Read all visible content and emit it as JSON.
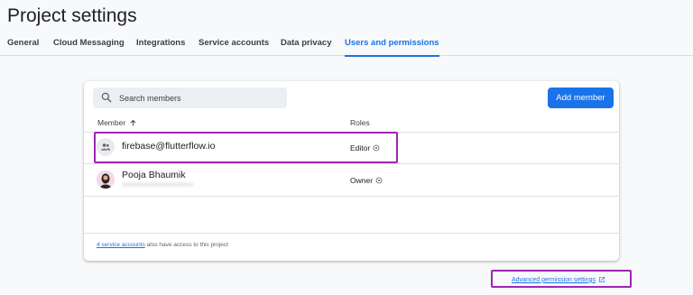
{
  "page_title": "Project settings",
  "tabs": [
    {
      "label": "General",
      "active": false
    },
    {
      "label": "Cloud Messaging",
      "active": false
    },
    {
      "label": "Integrations",
      "active": false
    },
    {
      "label": "Service accounts",
      "active": false
    },
    {
      "label": "Data privacy",
      "active": false
    },
    {
      "label": "Users and permissions",
      "active": true
    }
  ],
  "search": {
    "placeholder": "Search members",
    "icon": "search-icon"
  },
  "add_member_label": "Add member",
  "columns": {
    "member": "Member",
    "roles": "Roles",
    "sort_icon": "arrow-up-icon"
  },
  "members": [
    {
      "name": "firebase@flutterflow.io",
      "role": "Editor",
      "avatar": "group-icon"
    },
    {
      "name": "Pooja Bhaumik",
      "role": "Owner",
      "avatar": "user-photo"
    }
  ],
  "footer": {
    "link": "4 service accounts",
    "text": " also have access to this project"
  },
  "advanced_link": "Advanced permission settings",
  "colors": {
    "accent": "#1a73e8",
    "highlight": "#9c27b0"
  }
}
